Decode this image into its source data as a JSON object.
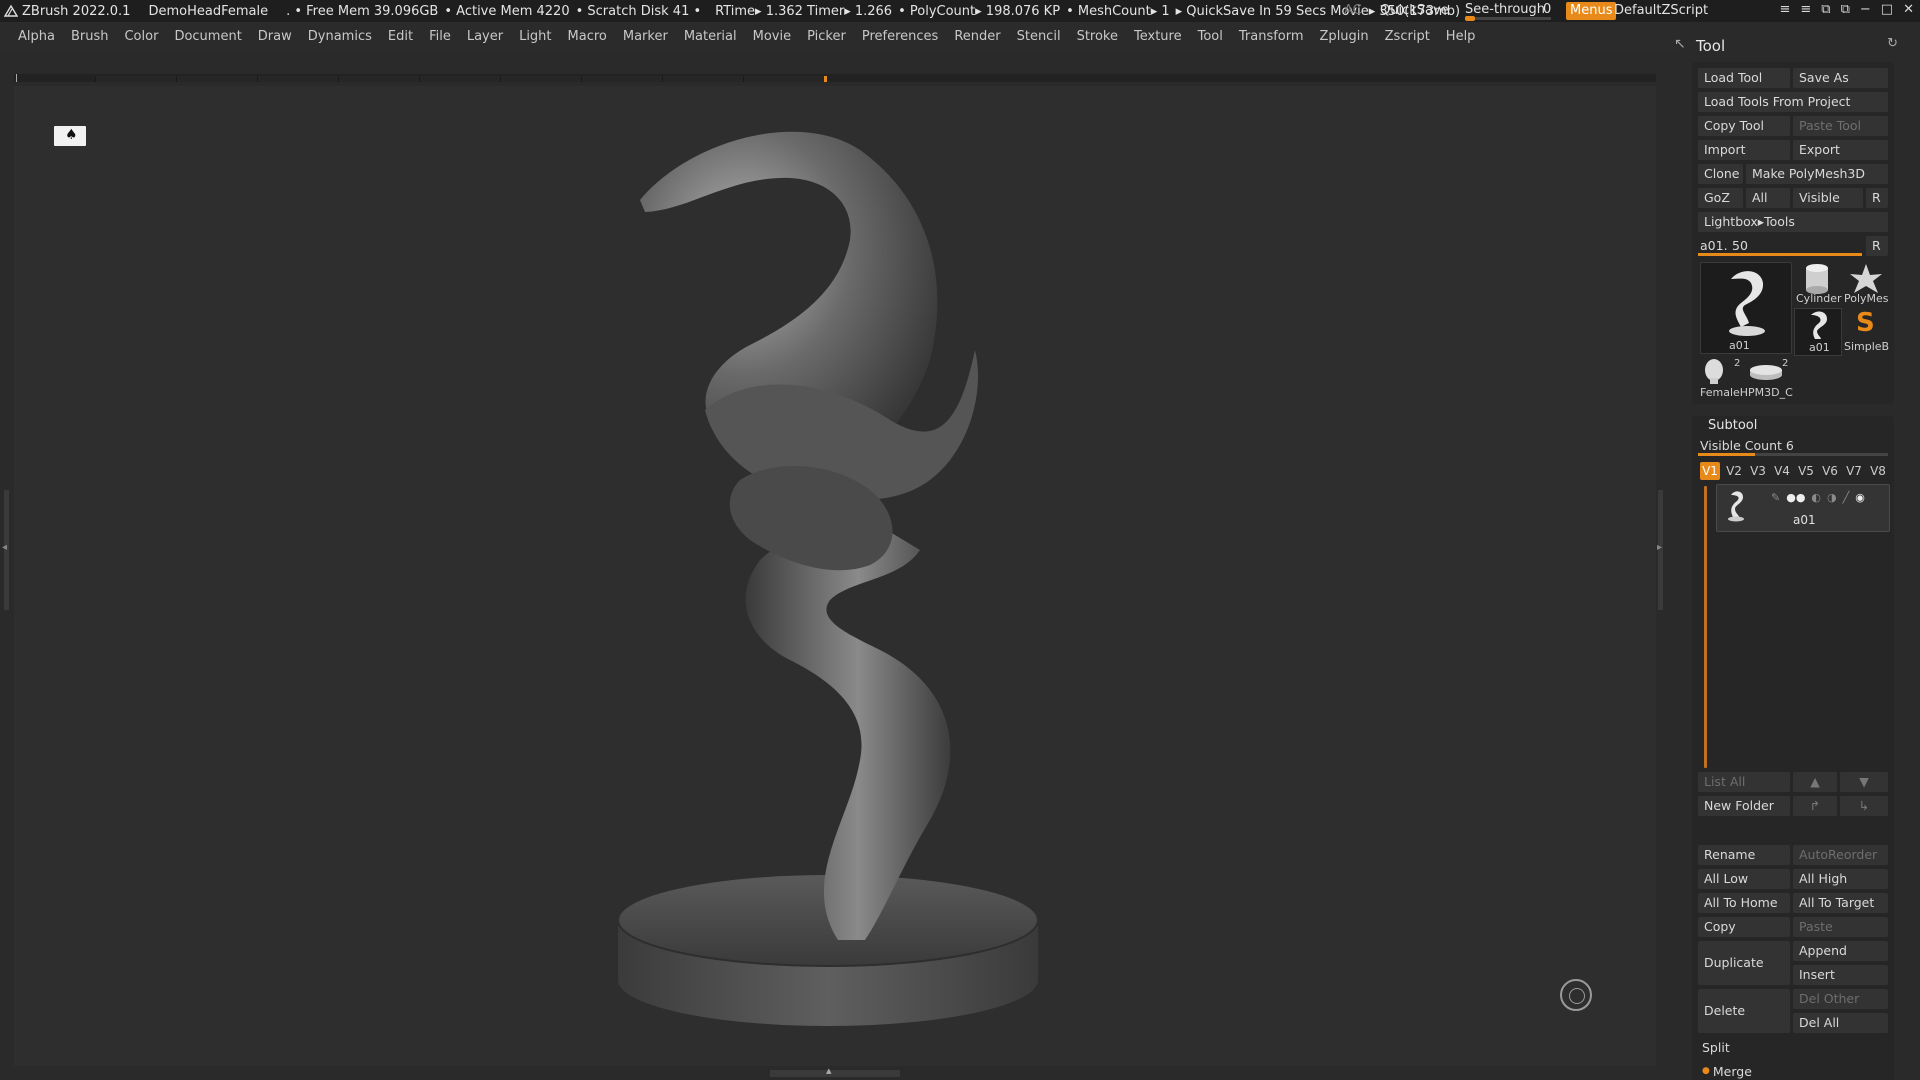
{
  "titlebar": {
    "app": "ZBrush 2022.0.1",
    "project": "DemoHeadFemale",
    "free_mem": ". • Free Mem 39.096GB",
    "active_mem": "• Active Mem 4220",
    "scratch": "• Scratch Disk 41 •",
    "rtime": "RTime▸ 1.362 Timer▸ 1.266",
    "polycount": "• PolyCount▸ 198.076 KP",
    "meshcount": "• MeshCount▸ 1",
    "quicksave_status": "▸ QuickSave In 59 Secs Movie▸ 350(173mb)",
    "ac_label": "AC",
    "quicksave_label": "QuickSave",
    "seethrough_label": "See-through",
    "seethrough_value": "0",
    "seethrough_level": 0,
    "menus_label": "Menus",
    "zscript_label": "DefaultZScript",
    "accent_color": "#e88a1a"
  },
  "menubar": {
    "items": [
      "Alpha",
      "Brush",
      "Color",
      "Document",
      "Draw",
      "Dynamics",
      "Edit",
      "File",
      "Layer",
      "Light",
      "Macro",
      "Marker",
      "Material",
      "Movie",
      "Picker",
      "Preferences",
      "Render",
      "Stencil",
      "Stroke",
      "Texture",
      "Tool",
      "Transform",
      "Zplugin",
      "Zscript",
      "Help"
    ]
  },
  "tool": {
    "title": "Tool",
    "load_tool": "Load Tool",
    "save_as": "Save As",
    "load_from_project": "Load Tools From Project",
    "copy_tool": "Copy Tool",
    "paste_tool": "Paste Tool",
    "import": "Import",
    "export": "Export",
    "clone": "Clone",
    "make_polymesh": "Make PolyMesh3D",
    "goz": "GoZ",
    "all": "All",
    "visible": "Visible",
    "r": "R",
    "lightbox": "Lightbox▸Tools",
    "slider_name": "a01.",
    "slider_value": "50",
    "slider_level": 1.0,
    "r2": "R",
    "thumbs": {
      "main": "a01",
      "cylinder": "Cylinder",
      "polymesh": "PolyMes",
      "a01_small": "a01",
      "simpleb": "SimpleB",
      "female": "FemaleH",
      "female_count": "2",
      "pm3d": "PM3D_C",
      "pm3d_count": "2"
    }
  },
  "subtool": {
    "title": "Subtool",
    "visible_count": "Visible Count 6",
    "visible_count_level": 0.3,
    "tabs": [
      "V1",
      "V2",
      "V3",
      "V4",
      "V5",
      "V6",
      "V7",
      "V8"
    ],
    "active_tab": "V1",
    "item_name": "a01",
    "list_all": "List All",
    "new_folder": "New Folder",
    "rename": "Rename",
    "auto_reorder": "AutoReorder",
    "all_low": "All Low",
    "all_high": "All High",
    "all_to_home": "All To Home",
    "all_to_target": "All To Target",
    "copy": "Copy",
    "paste": "Paste",
    "duplicate": "Duplicate",
    "append": "Append",
    "insert": "Insert",
    "delete": "Delete",
    "del_other": "Del Other",
    "del_all": "Del All",
    "split": "Split",
    "merge": "Merge"
  },
  "icons": [
    "zbrush-logo-icon",
    "wing-icon",
    "window-controls-icon",
    "pin-icon",
    "reset-icon",
    "navigate-icon",
    "gyro-icon",
    "move-up-icon",
    "move-down-icon",
    "eye-icon"
  ]
}
